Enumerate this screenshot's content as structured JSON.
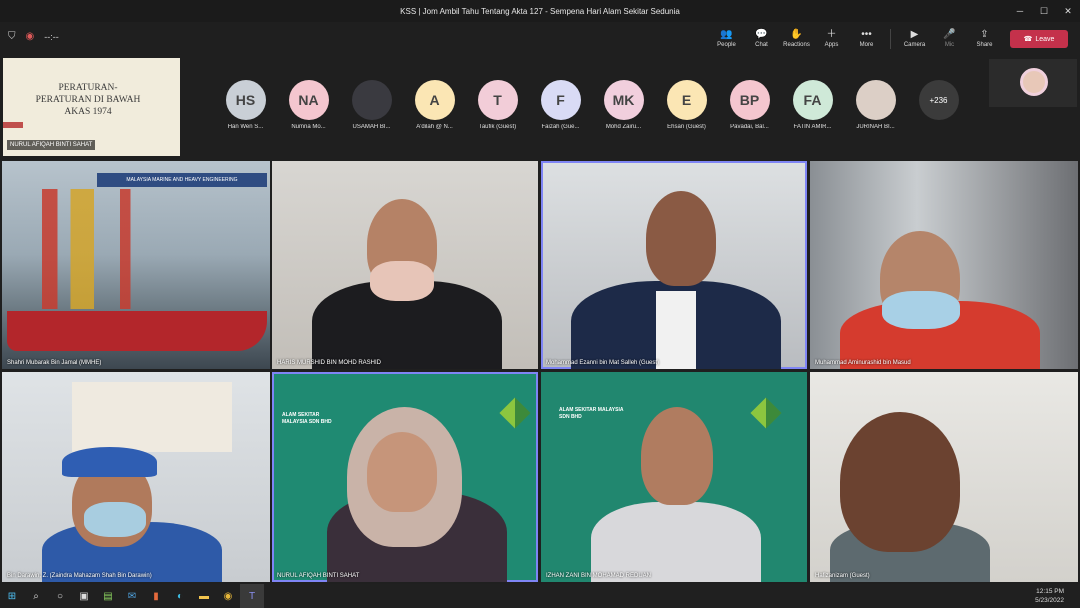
{
  "window": {
    "title": "KSS | Jom Ambil Tahu Tentang Akta 127 - Sempena Hari Alam Sekitar Sedunia"
  },
  "toolbar": {
    "timer": "--:--",
    "buttons": [
      {
        "label": "People",
        "icon": "people-icon"
      },
      {
        "label": "Chat",
        "icon": "chat-icon"
      },
      {
        "label": "Reactions",
        "icon": "reactions-icon"
      },
      {
        "label": "Apps",
        "icon": "apps-icon"
      },
      {
        "label": "More",
        "icon": "more-icon"
      },
      {
        "label": "Camera",
        "icon": "camera-icon"
      },
      {
        "label": "Mic",
        "icon": "mic-icon"
      },
      {
        "label": "Share",
        "icon": "share-icon"
      }
    ],
    "leave_label": "Leave"
  },
  "shared_screen": {
    "slide_text": "PERATURAN-PERATURAN DI BAWAH AKAS 1974",
    "presenter": "NURUL AFIQAH BINTI SAHAT"
  },
  "participants_strip": [
    {
      "initials": "HS",
      "name": "Han Wen S...",
      "color": "#c9cfd6"
    },
    {
      "initials": "NA",
      "name": "Numna Mo...",
      "color": "#f4c6cf"
    },
    {
      "initials": "",
      "name": "USAMAH BI...",
      "color": "#3a3a40"
    },
    {
      "initials": "A",
      "name": "A'dilah @ N...",
      "color": "#fbe6b4"
    },
    {
      "initials": "T",
      "name": "Taufik (Guest)",
      "color": "#f2cdd8"
    },
    {
      "initials": "F",
      "name": "Faizah (Gue...",
      "color": "#d9dbf5"
    },
    {
      "initials": "MK",
      "name": "Mohd Zairu...",
      "color": "#f1cfdd"
    },
    {
      "initials": "E",
      "name": "Ehsan (Guest)",
      "color": "#fbe6b4"
    },
    {
      "initials": "BP",
      "name": "Pavadai, Bal...",
      "color": "#f4c6cf"
    },
    {
      "initials": "FA",
      "name": "FATIN AMIR...",
      "color": "#cfe9d8"
    },
    {
      "initials": "",
      "name": "JURINAH BI...",
      "color": "#dccfc6"
    },
    {
      "initials": "+236",
      "name": "",
      "color": "#3b3b3b"
    }
  ],
  "video_tiles": [
    {
      "name": "Shahri Mubarak Bin Jamal (MMHE)"
    },
    {
      "name": "HARIS MURSHID BIN MOHD RASHID"
    },
    {
      "name": "Mohammad Ezanni bin Mat Salleh (Guest)"
    },
    {
      "name": "Muhammad Aminurashid bin Masud"
    },
    {
      "name": "Bin Darawin, Z. (Zaindra Mahazam Shah Bin Darawin)"
    },
    {
      "name": "NURUL AFIQAH BINTI SAHAT"
    },
    {
      "name": "IZHAN ZANI BIN MOHAMAD REDUAN"
    },
    {
      "name": "Hafizanizam (Guest)"
    }
  ],
  "tile_text": {
    "company": "ALAM SEKITAR MALAYSIA SDN BHD",
    "ship_banner": "MALAYSIA MARINE AND HEAVY ENGINEERING"
  },
  "taskbar": {
    "time": "12:15 PM",
    "date": "5/23/2022"
  }
}
